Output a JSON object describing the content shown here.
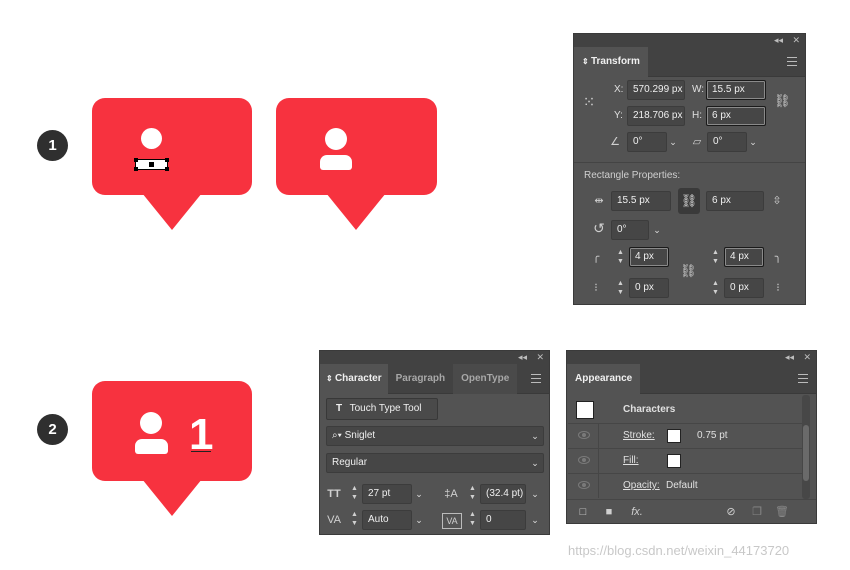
{
  "steps": [
    "1",
    "2"
  ],
  "transform_panel": {
    "title": "Transform",
    "x_label": "X:",
    "x_value": "570.299 px",
    "y_label": "Y:",
    "y_value": "218.706 px",
    "w_label": "W:",
    "w_value": "15.5 px",
    "h_label": "H:",
    "h_value": "6 px",
    "rotate_value": "0°",
    "shear_value": "0°",
    "rect_props_label": "Rectangle Properties:",
    "rect_width": "15.5 px",
    "rect_height": "6 px",
    "rect_rotation": "0°",
    "corner_tl": "4 px",
    "corner_tr": "4 px",
    "corner_bl": "0 px",
    "corner_br": "0 px"
  },
  "character_panel": {
    "tabs": [
      "Character",
      "Paragraph",
      "OpenType"
    ],
    "touch_type_label": "Touch Type Tool",
    "font_family": "Sniglet",
    "font_style": "Regular",
    "font_size": "27 pt",
    "leading": "(32.4 pt)",
    "kerning": "Auto",
    "tracking": "0"
  },
  "appearance_panel": {
    "title": "Appearance",
    "target": "Characters",
    "stroke_label": "Stroke:",
    "stroke_value": "0.75 pt",
    "fill_label": "Fill:",
    "opacity_label": "Opacity:",
    "opacity_value": "Default",
    "fx_label": "fx."
  },
  "bubble_number": "1",
  "watermark": "https://blog.csdn.net/weixin_44173720",
  "colors": {
    "bubble": "#f7323f",
    "panel": "#535353",
    "panel_header": "#424242"
  }
}
